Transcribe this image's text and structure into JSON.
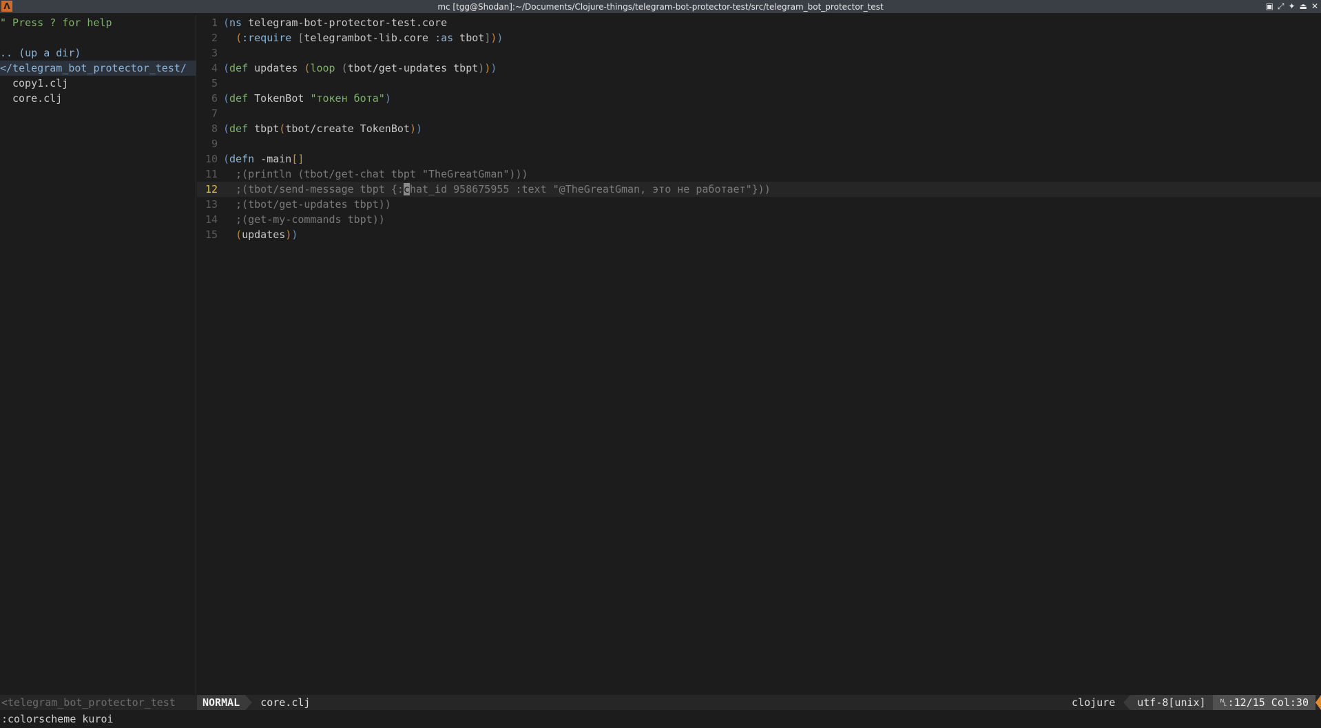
{
  "window": {
    "title": "mc [tgg@Shodan]:~/Documents/Clojure-things/telegram-bot-protector-test/src/telegram_bot_protector_test",
    "app_icon": "Λ",
    "controls": [
      "▣",
      "⤢",
      "✦",
      "⏏",
      "✕"
    ]
  },
  "tree": {
    "help": "\" Press ? for help",
    "updir": ".. (up a dir)",
    "cwd": "</telegram_bot_protector_test/",
    "files": [
      "copy1.clj",
      "core.clj"
    ]
  },
  "editor": {
    "lines": [
      {
        "n": "1",
        "text": "(ns telegram-bot-protector-test.core"
      },
      {
        "n": "2",
        "text": "  (:require [telegrambot-lib.core :as tbot]))"
      },
      {
        "n": "3",
        "text": ""
      },
      {
        "n": "4",
        "text": "(def updates (loop (tbot/get-updates tbpt)))"
      },
      {
        "n": "5",
        "text": ""
      },
      {
        "n": "6",
        "text": "(def TokenBot \"токен бота\")"
      },
      {
        "n": "7",
        "text": ""
      },
      {
        "n": "8",
        "text": "(def tbpt(tbot/create TokenBot))"
      },
      {
        "n": "9",
        "text": ""
      },
      {
        "n": "10",
        "text": "(defn -main[]"
      },
      {
        "n": "11",
        "text": "  ;(println (tbot/get-chat tbpt \"TheGreatGman\")))"
      },
      {
        "n": "12",
        "text": "  ;(tbot/send-message tbpt {:chat_id 958675955 :text \"@TheGreatGman, это не работает\"}))"
      },
      {
        "n": "13",
        "text": "  ;(tbot/get-updates tbpt))"
      },
      {
        "n": "14",
        "text": "  ;(get-my-commands tbpt))"
      },
      {
        "n": "15",
        "text": "  (updates))"
      }
    ],
    "current_line": "12"
  },
  "status": {
    "left": "<telegram_bot_protector_test",
    "mode": "NORMAL",
    "filename": "core.clj",
    "filetype": "clojure",
    "encoding": "utf-8[unix]",
    "position": "␤:12/15 Col:30"
  },
  "cmdline": ":colorscheme kuroi"
}
